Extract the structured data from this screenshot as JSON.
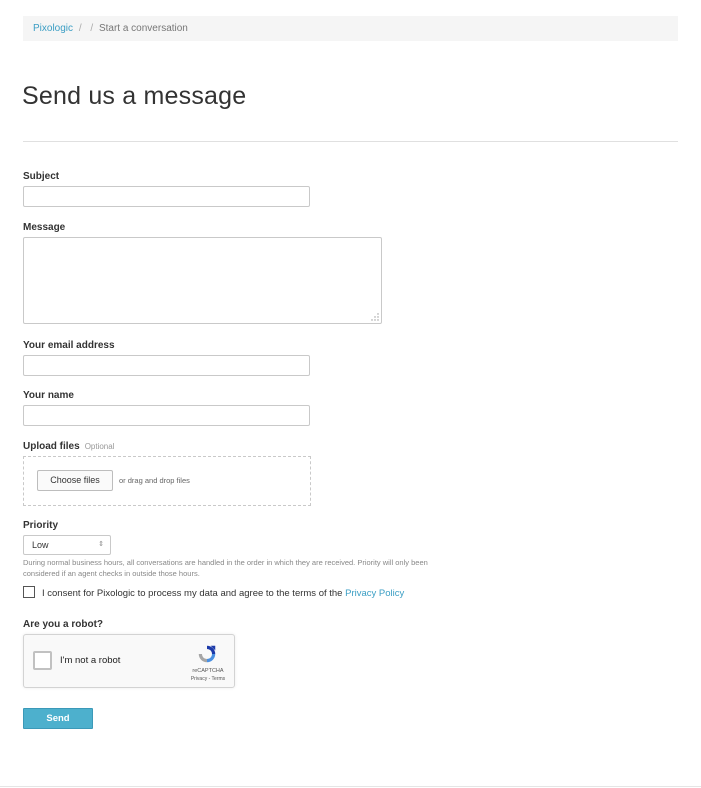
{
  "breadcrumb": {
    "home": "Pixologic",
    "sep1": "/",
    "sep2": "/",
    "current": "Start a conversation"
  },
  "title": "Send us a message",
  "form": {
    "subject_label": "Subject",
    "subject_value": "",
    "message_label": "Message",
    "message_value": "",
    "email_label": "Your email address",
    "email_value": "",
    "name_label": "Your name",
    "name_value": "",
    "upload_label": "Upload files",
    "upload_optional": "Optional",
    "choose_files_label": "Choose files",
    "drag_hint": "or drag and drop files",
    "priority_label": "Priority",
    "priority_value": "Low",
    "priority_help": "During normal business hours, all conversations are handled in the order in which they are received. Priority will only been considered if an agent checks in outside those hours.",
    "consent_text": "I consent for Pixologic to process my data and agree to the terms of the ",
    "consent_link": "Privacy Policy",
    "consent_checked": false,
    "robot_label": "Are you a robot?",
    "send_label": "Send"
  },
  "recaptcha": {
    "label": "I'm not a robot",
    "brand": "reCAPTCHA",
    "terms": "Privacy - Terms",
    "icon": "recaptcha-logo-icon"
  },
  "colors": {
    "accent": "#3b9ec4",
    "button": "#4db0cd",
    "breadcrumb_bg": "#f5f5f5"
  }
}
